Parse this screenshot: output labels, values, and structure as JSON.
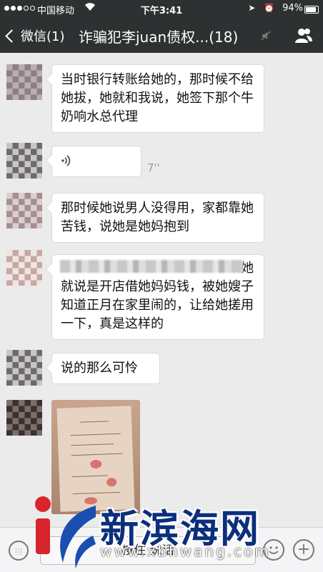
{
  "status_bar": {
    "carrier": "中国移动",
    "time": "下午3:41",
    "battery": "94%"
  },
  "nav": {
    "back_label": "微信(1)",
    "title": "诈骗犯李juan债权...(18)"
  },
  "messages": [
    {
      "type": "text",
      "text": "当时银行转账给她的，那时候不给她拔，她就和我说，她签下那个牛奶响水总代理"
    },
    {
      "type": "voice",
      "duration": "7''"
    },
    {
      "type": "text",
      "text": "那时候她说男人没得用，家都靠她苦钱，说她是她妈抱到"
    },
    {
      "type": "text",
      "suffix": "她",
      "text": "就说是开店借她妈妈钱，被她嫂子知道正月在家里闹的，让给她搓用一下，真是这样的"
    },
    {
      "type": "text",
      "text": "说的那么可怜"
    },
    {
      "type": "image",
      "image": "handwritten-iou-document"
    }
  ],
  "input_bar": {
    "press_to_talk": "按住 说话"
  },
  "watermark": {
    "brand": "新滨海网",
    "domain": "www.xbhwang.com"
  }
}
